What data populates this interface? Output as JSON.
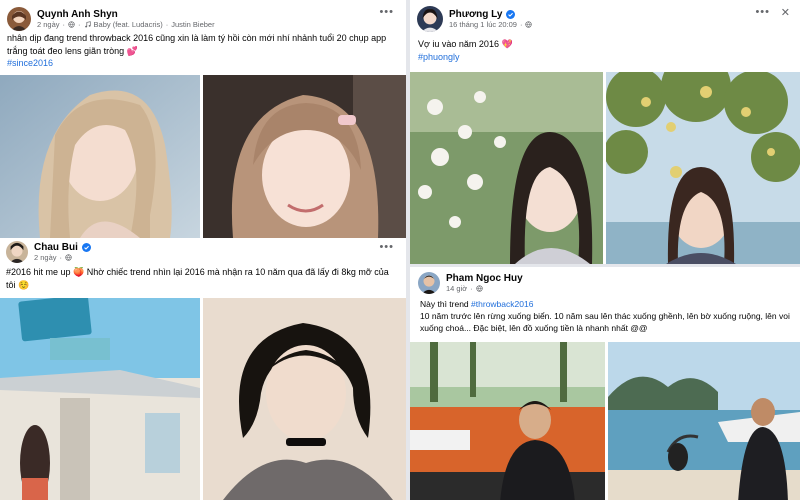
{
  "left_column": {
    "post1": {
      "author": "Quynh Anh Shyn",
      "time": "2 ngày",
      "music": "Baby (feat. Ludacris)",
      "music_artist": "Justin Bieber",
      "text": "nhân dịp đang trend throwback 2016 cũng xin là làm tý hồi còn mới nhí nhảnh tuổi 20 chụp app trắng toát đeo lens giãn tròng",
      "emoji": "💕",
      "hashtag": "#since2016"
    },
    "post2": {
      "author": "Chau Bui",
      "time": "2 ngày",
      "text": "#2016 hit me up 🍑 Nhờ chiếc trend nhìn lại 2016 mà nhận ra 10 năm qua đã lấy đi 8kg mỡ của tôi",
      "emoji": "☺️"
    }
  },
  "right_column": {
    "post1": {
      "author": "Phương Ly",
      "time": "16 tháng 1 lúc 20:09",
      "text": "Vợ iu vào năm 2016",
      "emoji": "💖",
      "hashtag": "#phuongly"
    },
    "post2": {
      "author": "Pham Ngoc Huy",
      "time": "14 giờ",
      "text_prefix": "Này thì trend",
      "hashtag": "#throwback2016",
      "text": "10 năm trước lên rừng xuống biển. 10 năm sau lên thác xuống ghềnh, lên bờ xuống ruộng, lên voi xuống choá... Đặc biệt, lên đồ xuống tiền là nhanh nhất @@"
    }
  },
  "ui": {
    "more_symbol": "•••",
    "close_symbol": "✕",
    "dot_separator": "·",
    "music_separator": "·"
  },
  "colors": {
    "hashtag": "#216fdb",
    "verified": "#1877f2",
    "secondary_text": "#65676b",
    "divider": "#e4e6eb"
  },
  "icons": {
    "verified": "verified-badge-icon",
    "globe": "globe-icon",
    "music": "music-note-icon",
    "more": "more-options-icon",
    "close": "close-icon"
  }
}
